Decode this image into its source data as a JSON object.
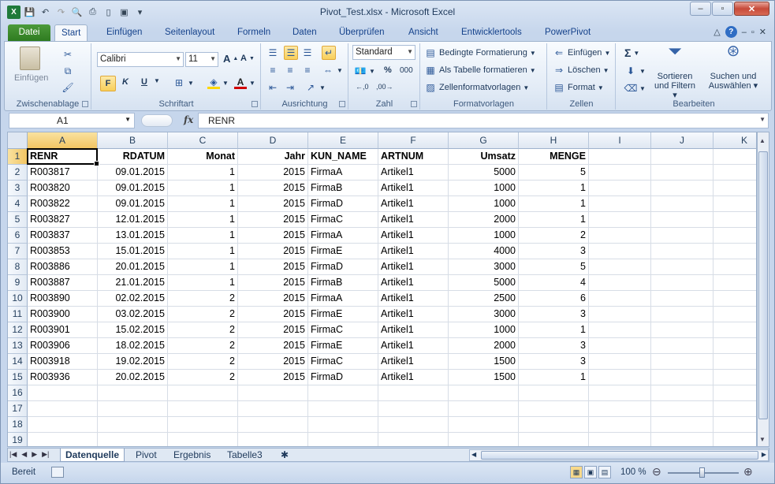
{
  "window": {
    "title": "Pivot_Test.xlsx - Microsoft Excel"
  },
  "tabs": [
    "Datei",
    "Start",
    "Einfügen",
    "Seitenlayout",
    "Formeln",
    "Daten",
    "Überprüfen",
    "Ansicht",
    "Entwicklertools",
    "PowerPivot"
  ],
  "ribbon": {
    "clipboard": {
      "label": "Zwischenablage",
      "paste": "Einfügen"
    },
    "font": {
      "label": "Schriftart",
      "name": "Calibri",
      "size": "11",
      "bold": "F",
      "italic": "K",
      "underline": "U"
    },
    "alignment": {
      "label": "Ausrichtung"
    },
    "number": {
      "label": "Zahl",
      "format": "Standard",
      "percent": "%",
      "thousands": "000"
    },
    "styles": {
      "label": "Formatvorlagen",
      "cond": "Bedingte Formatierung",
      "table": "Als Tabelle formatieren",
      "cellstyles": "Zellenformatvorlagen"
    },
    "cells": {
      "label": "Zellen",
      "insert": "Einfügen",
      "delete": "Löschen",
      "format": "Format"
    },
    "editing": {
      "label": "Bearbeiten",
      "sort1": "Sortieren",
      "sort2": "und Filtern",
      "find1": "Suchen und",
      "find2": "Auswählen"
    }
  },
  "formula": {
    "namebox": "A1",
    "fx": "fx",
    "value": "RENR"
  },
  "columns": [
    "A",
    "B",
    "C",
    "D",
    "E",
    "F",
    "G",
    "H",
    "I",
    "J",
    "K"
  ],
  "headers": [
    "RENR",
    "RDATUM",
    "Monat",
    "Jahr",
    "KUN_NAME",
    "ARTNUM",
    "Umsatz",
    "MENGE"
  ],
  "rows": [
    [
      "R003817",
      "09.01.2015",
      "1",
      "2015",
      "FirmaA",
      "Artikel1",
      "5000",
      "5"
    ],
    [
      "R003820",
      "09.01.2015",
      "1",
      "2015",
      "FirmaB",
      "Artikel1",
      "1000",
      "1"
    ],
    [
      "R003822",
      "09.01.2015",
      "1",
      "2015",
      "FirmaD",
      "Artikel1",
      "1000",
      "1"
    ],
    [
      "R003827",
      "12.01.2015",
      "1",
      "2015",
      "FirmaC",
      "Artikel1",
      "2000",
      "1"
    ],
    [
      "R003837",
      "13.01.2015",
      "1",
      "2015",
      "FirmaA",
      "Artikel1",
      "1000",
      "2"
    ],
    [
      "R003853",
      "15.01.2015",
      "1",
      "2015",
      "FirmaE",
      "Artikel1",
      "4000",
      "3"
    ],
    [
      "R003886",
      "20.01.2015",
      "1",
      "2015",
      "FirmaD",
      "Artikel1",
      "3000",
      "5"
    ],
    [
      "R003887",
      "21.01.2015",
      "1",
      "2015",
      "FirmaB",
      "Artikel1",
      "5000",
      "4"
    ],
    [
      "R003890",
      "02.02.2015",
      "2",
      "2015",
      "FirmaA",
      "Artikel1",
      "2500",
      "6"
    ],
    [
      "R003900",
      "03.02.2015",
      "2",
      "2015",
      "FirmaE",
      "Artikel1",
      "3000",
      "3"
    ],
    [
      "R003901",
      "15.02.2015",
      "2",
      "2015",
      "FirmaC",
      "Artikel1",
      "1000",
      "1"
    ],
    [
      "R003906",
      "18.02.2015",
      "2",
      "2015",
      "FirmaE",
      "Artikel1",
      "2000",
      "3"
    ],
    [
      "R003918",
      "19.02.2015",
      "2",
      "2015",
      "FirmaC",
      "Artikel1",
      "1500",
      "3"
    ],
    [
      "R003936",
      "20.02.2015",
      "2",
      "2015",
      "FirmaD",
      "Artikel1",
      "1500",
      "1"
    ]
  ],
  "row_numbers": [
    "1",
    "2",
    "3",
    "4",
    "5",
    "6",
    "7",
    "8",
    "9",
    "10",
    "11",
    "12",
    "13",
    "14",
    "15",
    "16",
    "17",
    "18",
    "19"
  ],
  "sheets": [
    "Datenquelle",
    "Pivot",
    "Ergebnis",
    "Tabelle3"
  ],
  "status": {
    "mode": "Bereit",
    "zoom": "100 %"
  }
}
